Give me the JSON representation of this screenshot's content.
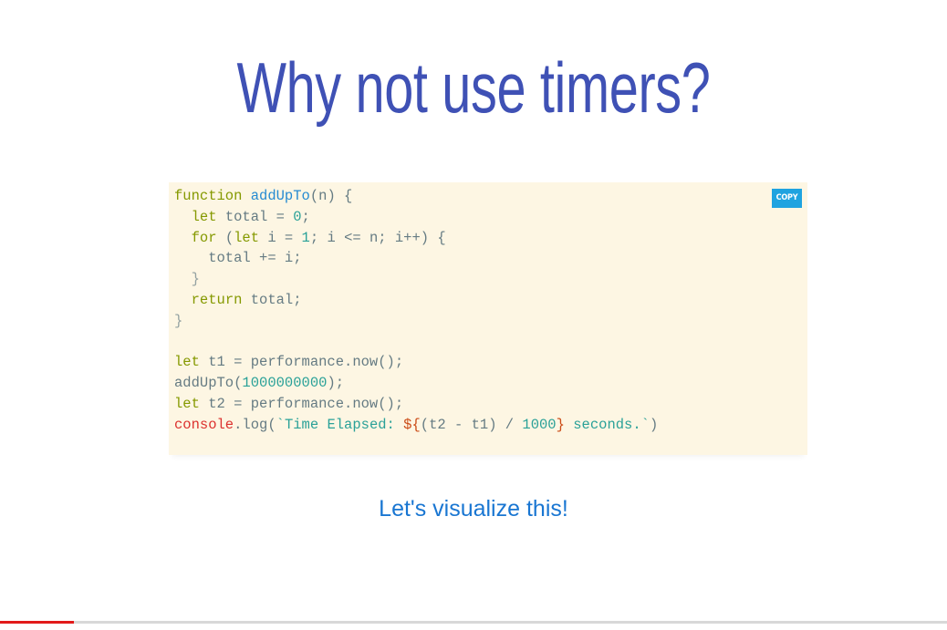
{
  "slide": {
    "title": "Why not use timers?",
    "subtitle_link": "Let's visualize this!"
  },
  "code_block": {
    "copy_label": "COPY",
    "lines": [
      [
        {
          "t": "function ",
          "c": "kw"
        },
        {
          "t": "addUpTo",
          "c": "fn"
        },
        {
          "t": "(n) {",
          "c": ""
        }
      ],
      [
        {
          "t": "  ",
          "c": ""
        },
        {
          "t": "let",
          "c": "kw"
        },
        {
          "t": " total = ",
          "c": ""
        },
        {
          "t": "0",
          "c": "num"
        },
        {
          "t": ";",
          "c": ""
        }
      ],
      [
        {
          "t": "  ",
          "c": ""
        },
        {
          "t": "for",
          "c": "kw"
        },
        {
          "t": " (",
          "c": ""
        },
        {
          "t": "let",
          "c": "kw"
        },
        {
          "t": " i = ",
          "c": ""
        },
        {
          "t": "1",
          "c": "num"
        },
        {
          "t": "; i <= n; i++) {",
          "c": ""
        }
      ],
      [
        {
          "t": "    total += i;",
          "c": ""
        }
      ],
      [
        {
          "t": "  }",
          "c": "pun"
        }
      ],
      [
        {
          "t": "  ",
          "c": ""
        },
        {
          "t": "return",
          "c": "kw"
        },
        {
          "t": " total;",
          "c": ""
        }
      ],
      [
        {
          "t": "}",
          "c": "pun"
        }
      ],
      [
        {
          "t": "",
          "c": ""
        }
      ],
      [
        {
          "t": "let",
          "c": "kw"
        },
        {
          "t": " t1 = performance.now();",
          "c": ""
        }
      ],
      [
        {
          "t": "addUpTo(",
          "c": ""
        },
        {
          "t": "1000000000",
          "c": "num"
        },
        {
          "t": ");",
          "c": ""
        }
      ],
      [
        {
          "t": "let",
          "c": "kw"
        },
        {
          "t": " t2 = performance.now();",
          "c": ""
        }
      ],
      [
        {
          "t": "console",
          "c": "red"
        },
        {
          "t": ".log(",
          "c": ""
        },
        {
          "t": "`Time Elapsed: ",
          "c": "str"
        },
        {
          "t": "${",
          "c": "interp"
        },
        {
          "t": "(t2 - t1) / ",
          "c": ""
        },
        {
          "t": "1000",
          "c": "num"
        },
        {
          "t": "}",
          "c": "interp"
        },
        {
          "t": " seconds.`",
          "c": "str"
        },
        {
          "t": ")",
          "c": ""
        }
      ]
    ]
  },
  "progress": {
    "fraction": 0.078,
    "fill_color": "#e21a1a",
    "track_color": "#d8d8d8"
  },
  "colors": {
    "title": "#3f51b5",
    "link": "#1976d2",
    "code_bg": "#fdf6e3",
    "copy_button": "#1fa3e0"
  }
}
